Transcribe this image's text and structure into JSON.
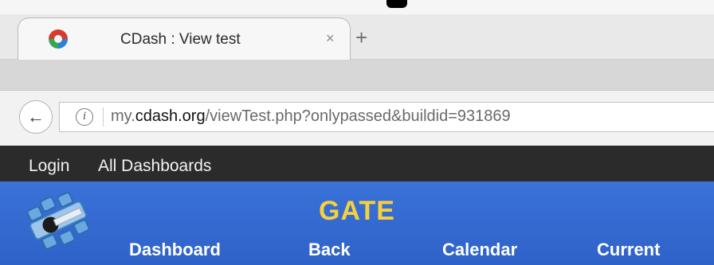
{
  "browser": {
    "tab_title": "CDash : View test",
    "tab_close_glyph": "×",
    "new_tab_glyph": "+",
    "back_glyph": "←",
    "info_glyph": "i",
    "url_prefix": "my.",
    "url_domain": "cdash.org",
    "url_path": "/viewTest.php?onlypassed&buildid=931869",
    "favicon_icon": "cdash-favicon-icon",
    "tab_close_icon": "close-tab-icon",
    "new_tab_icon": "new-tab-icon",
    "back_icon": "back-arrow-icon",
    "info_icon": "site-info-icon"
  },
  "topnav": {
    "login": "Login",
    "all_dashboards": "All Dashboards",
    "background": "#2b2b2b"
  },
  "header": {
    "project_name": "GATE",
    "nav": [
      "Dashboard",
      "Back",
      "Calendar",
      "Current"
    ],
    "logo_icon": "project-logo-icon",
    "title_color": "#f7d03c",
    "background": "#3a72d8"
  }
}
